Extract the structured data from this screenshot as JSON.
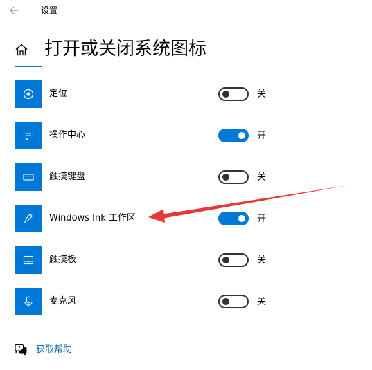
{
  "window": {
    "app_title": "设置",
    "back_icon": "arrow-left-icon",
    "home_icon": "home-icon"
  },
  "page": {
    "title": "打开或关闭系统图标"
  },
  "colors": {
    "accent": "#0078d7",
    "link": "#0063b1",
    "annotation_arrow": "#e53935"
  },
  "items": [
    {
      "label": "定位",
      "icon": "location-icon",
      "state": "关",
      "on": false
    },
    {
      "label": "操作中心",
      "icon": "action-center-icon",
      "state": "开",
      "on": true
    },
    {
      "label": "触摸键盘",
      "icon": "keyboard-icon",
      "state": "关",
      "on": false
    },
    {
      "label": "Windows Ink 工作区",
      "icon": "pen-icon",
      "state": "开",
      "on": true
    },
    {
      "label": "触摸板",
      "icon": "touchpad-icon",
      "state": "关",
      "on": false
    },
    {
      "label": "麦克风",
      "icon": "microphone-icon",
      "state": "关",
      "on": false
    }
  ],
  "help": {
    "label": "获取帮助",
    "icon": "help-chat-icon"
  }
}
